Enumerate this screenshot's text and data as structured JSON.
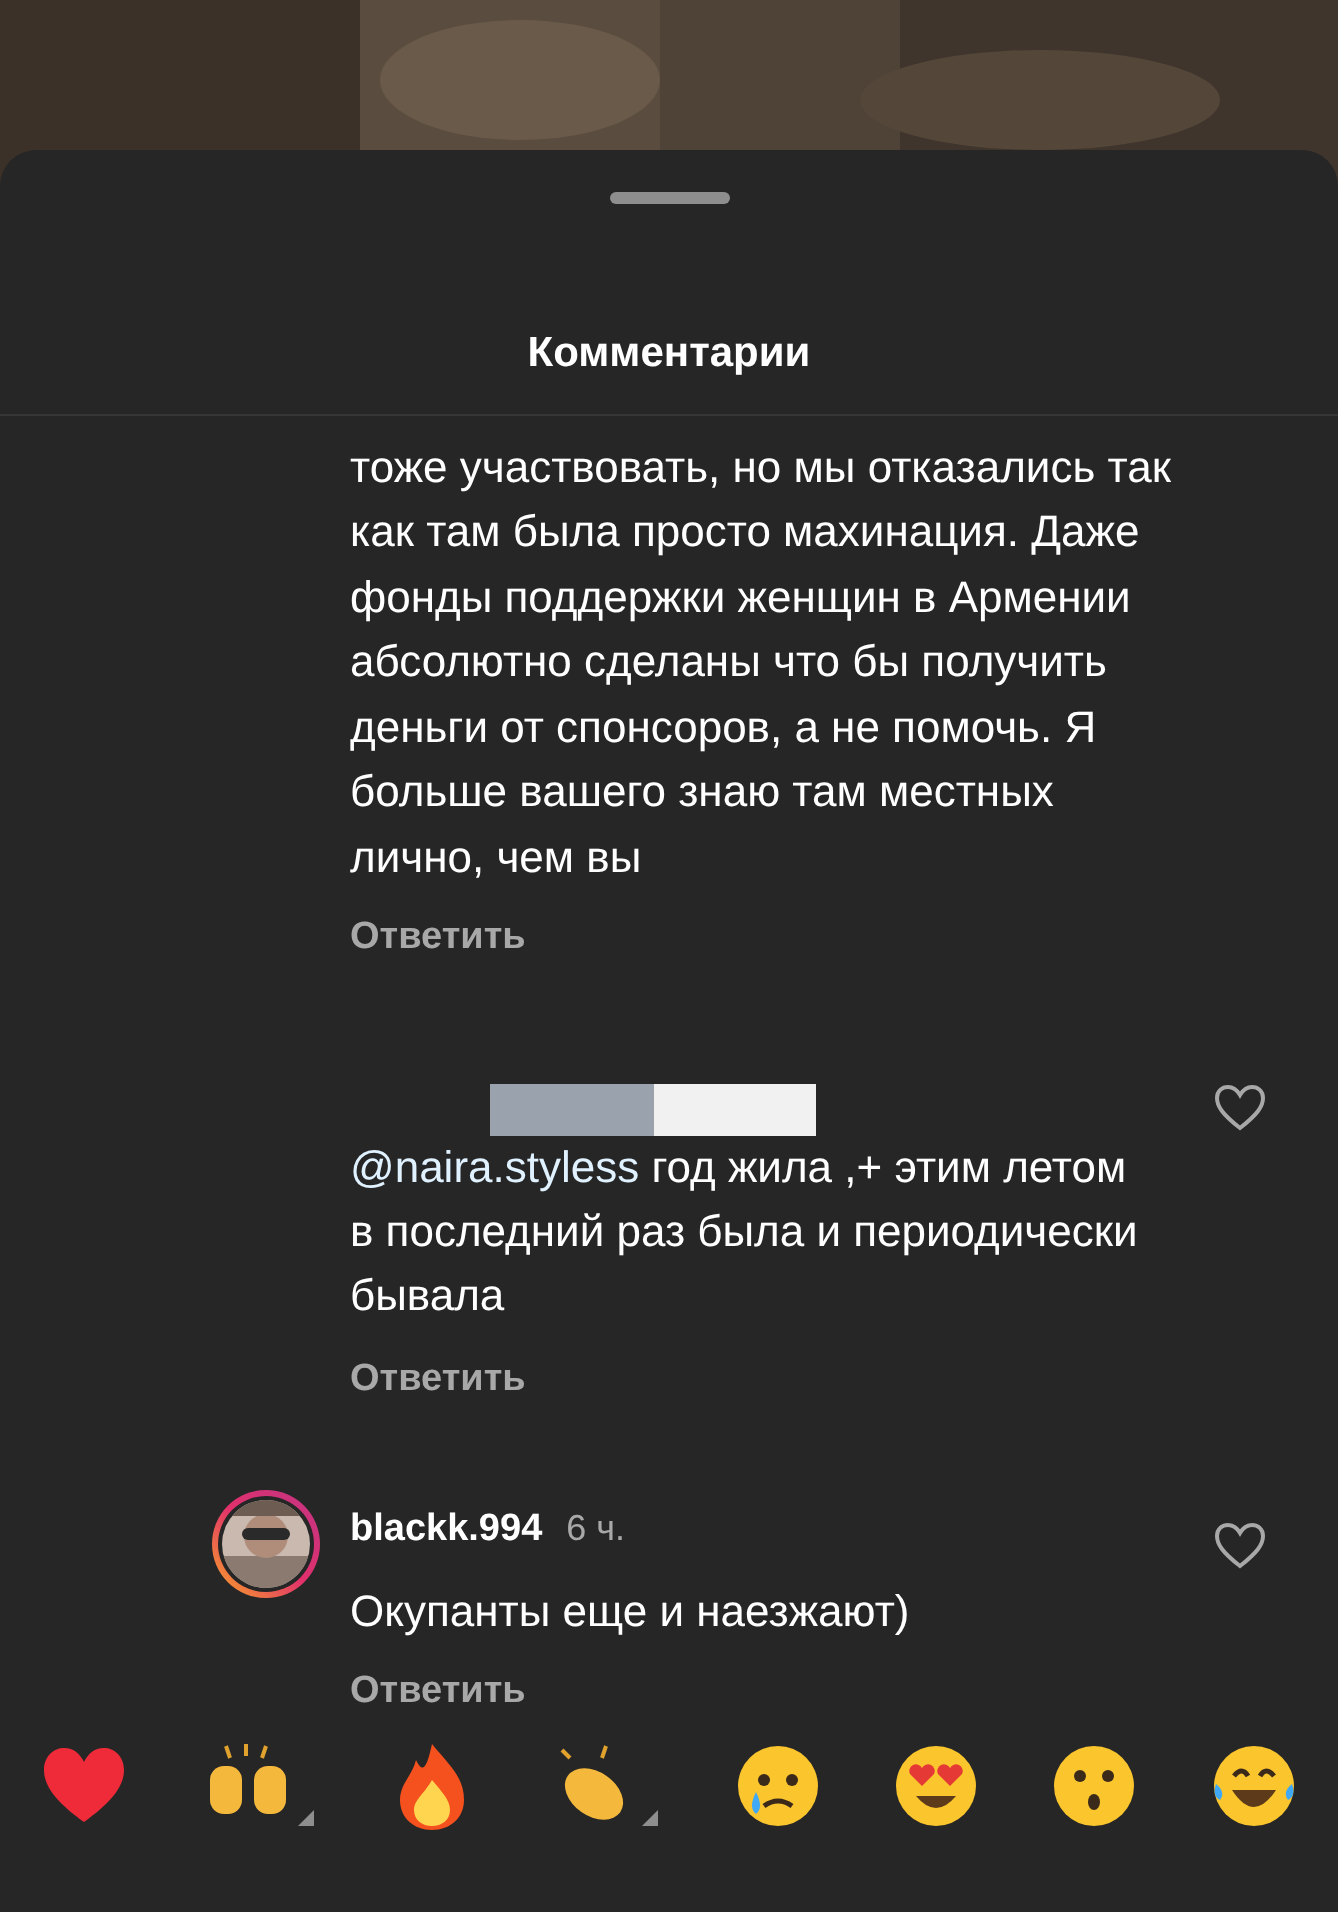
{
  "header": {
    "title": "Комментарии"
  },
  "comments": [
    {
      "kind": "continued",
      "text": "тоже участвовать, но мы отказались так как там была просто махинация. Даже фонды поддержки женщин в Армении абсолютно сделаны что бы получить деньги от спонсоров, а не помочь. Я больше вашего знаю там местных лично, чем вы",
      "reply": "Ответить"
    },
    {
      "kind": "redacted",
      "mention": "@naira.styless",
      "text": "год жила ,+ этим летом в последний раз была и периодически бывала",
      "reply": "Ответить",
      "liked": false
    },
    {
      "kind": "full",
      "username": "blackk.994",
      "time": "6 ч.",
      "text": "Окупанты еще и наезжают)",
      "reply": "Ответить",
      "liked": false
    }
  ]
}
